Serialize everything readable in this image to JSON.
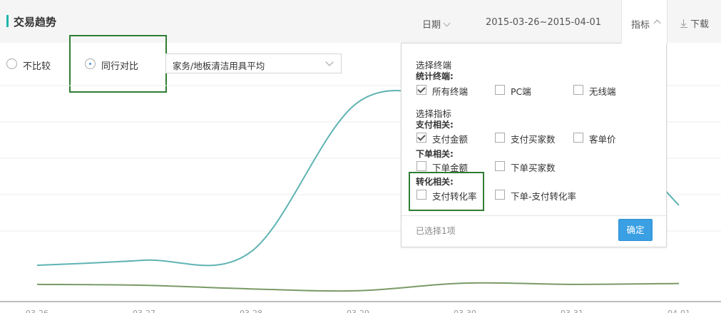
{
  "header": {
    "title": "交易趋势",
    "date_label": "日期",
    "date_range": "2015-03-26~2015-04-01",
    "metric_label": "指标",
    "download_label": "下载"
  },
  "compare": {
    "options": [
      {
        "label": "不比较",
        "selected": false
      },
      {
        "label": "同行对比",
        "selected": true
      }
    ],
    "select_value": "家务/地板清洁用具平均"
  },
  "panel": {
    "terminal_section": "选择终端",
    "terminal_group": "统计终端:",
    "terminals": [
      {
        "label": "所有终端",
        "checked": true
      },
      {
        "label": "PC端",
        "checked": false
      },
      {
        "label": "无线端",
        "checked": false
      }
    ],
    "metric_section": "选择指标",
    "groups": [
      {
        "title": "支付相关:",
        "items": [
          {
            "label": "支付金额",
            "checked": true
          },
          {
            "label": "支付买家数",
            "checked": false
          },
          {
            "label": "客单价",
            "checked": false
          }
        ]
      },
      {
        "title": "下单相关:",
        "items": [
          {
            "label": "下单金额",
            "checked": false
          },
          {
            "label": "下单买家数",
            "checked": false
          }
        ]
      },
      {
        "title": "转化相关:",
        "items": [
          {
            "label": "支付转化率",
            "checked": false
          },
          {
            "label": "下单-支付转化率",
            "checked": false
          }
        ]
      }
    ],
    "selected_count": "已选择1项",
    "confirm_label": "确定"
  },
  "colors": {
    "accent": "#1fb5ad",
    "series_1": "#5fb3b3",
    "series_2": "#7a9a66",
    "confirm": "#3a9fe3",
    "highlight": "#2e7d32"
  },
  "chart_data": {
    "type": "line",
    "x": [
      "03-26",
      "03-27",
      "03-28",
      "03-29",
      "03-30",
      "03-31",
      "04-01"
    ],
    "series": [
      {
        "values": [
          100,
          128,
          175,
          1000,
          1010,
          1005,
          432
        ]
      },
      {
        "values": [
          -5,
          -10,
          -30,
          -40,
          2,
          -5,
          0
        ]
      }
    ],
    "ylim": [
      -100,
      1100
    ],
    "grid": true
  }
}
